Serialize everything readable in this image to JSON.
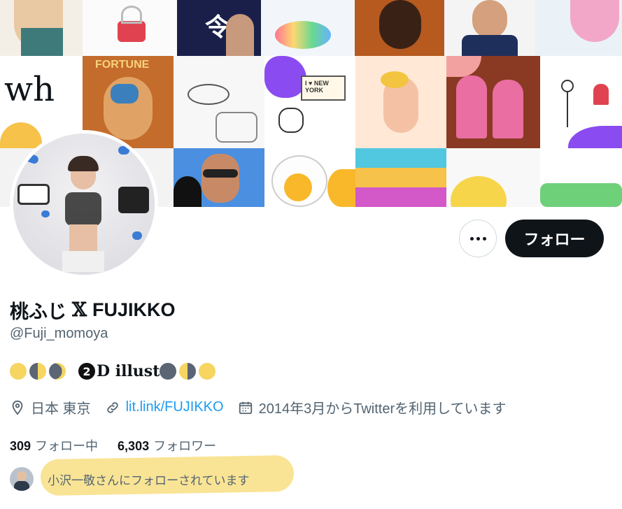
{
  "profile": {
    "name": "桃ふじ",
    "name_suffix": "FUJIKKO",
    "x_mark": "𝕏",
    "handle": "@Fuji_momoya",
    "bio_text": "D illust",
    "bio_number": "2",
    "location": "日本 東京",
    "link": "lit.link/FUJIKKO",
    "joined": "2014年3月からTwitterを利用しています",
    "following_count": "309",
    "following_label": "フォロー中",
    "followers_count": "6,303",
    "followers_label": "フォロワー",
    "followed_by": "小沢一敬さんにフォローされています"
  },
  "actions": {
    "follow_label": "フォロー"
  },
  "banner": {
    "texts": {
      "newyork": "I ♥ NEW YORK",
      "rei": "令",
      "fortune": "FORTUNE"
    }
  },
  "colors": {
    "accent_link": "#1d9bf0",
    "text_secondary": "#536471",
    "follow_button": "#0f1419",
    "highlight": "#f8e189",
    "purple_blob": "#8a4cf0"
  }
}
